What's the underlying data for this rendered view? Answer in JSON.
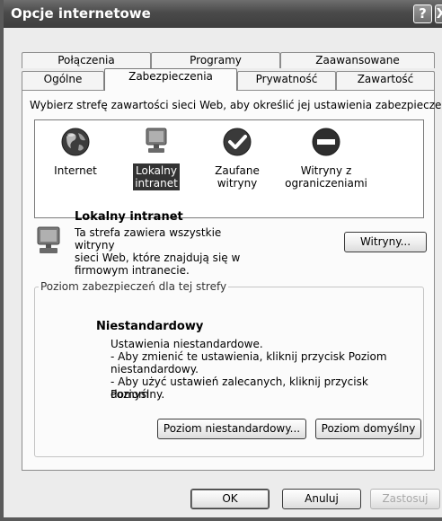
{
  "window": {
    "title": "Opcje internetowe",
    "help_glyph": "?",
    "close_glyph": "X"
  },
  "tabs": {
    "back_row": [
      "Połączenia",
      "Programy",
      "Zaawansowane"
    ],
    "front_row": [
      "Ogólne",
      "Zabezpieczenia",
      "Prywatność",
      "Zawartość"
    ],
    "selected": "Zabezpieczenia"
  },
  "security": {
    "instruction": "Wybierz strefę zawartości sieci Web, aby określić jej ustawienia zabezpieczeń.",
    "zones": [
      {
        "label_line1": "Internet",
        "label_line2": "",
        "icon": "globe-icon"
      },
      {
        "label_line1": "Lokalny",
        "label_line2": "intranet",
        "icon": "computer-icon",
        "selected": true
      },
      {
        "label_line1": "Zaufane",
        "label_line2": "witryny",
        "icon": "checkmark-icon"
      },
      {
        "label_line1": "Witryny z",
        "label_line2": "ograniczeniami",
        "icon": "no-entry-icon"
      }
    ],
    "zone_info": {
      "title": "Lokalny intranet",
      "desc_lines": [
        "Ta strefa zawiera wszystkie witryny",
        "sieci Web, które znajdują się w",
        "firmowym intranecie."
      ],
      "sites_button": "Witryny..."
    },
    "level_group": {
      "legend": "Poziom zabezpieczeń dla tej strefy",
      "level_title": "Niestandardowy",
      "lines": [
        "Ustawienia niestandardowe.",
        "- Aby zmienić te ustawienia, kliknij przycisk Poziom",
        "niestandardowy.",
        "- Aby użyć ustawień zalecanych, kliknij przycisk Poziom",
        "domyślny."
      ],
      "custom_button": "Poziom niestandardowy...",
      "default_button": "Poziom domyślny"
    }
  },
  "footer": {
    "ok": "OK",
    "cancel": "Anuluj",
    "apply": "Zastosuj"
  },
  "colors": {
    "titlebar": "#4a4a4a",
    "panel": "#fbfbfb",
    "dialog": "#ececec",
    "selection": "#333333"
  }
}
